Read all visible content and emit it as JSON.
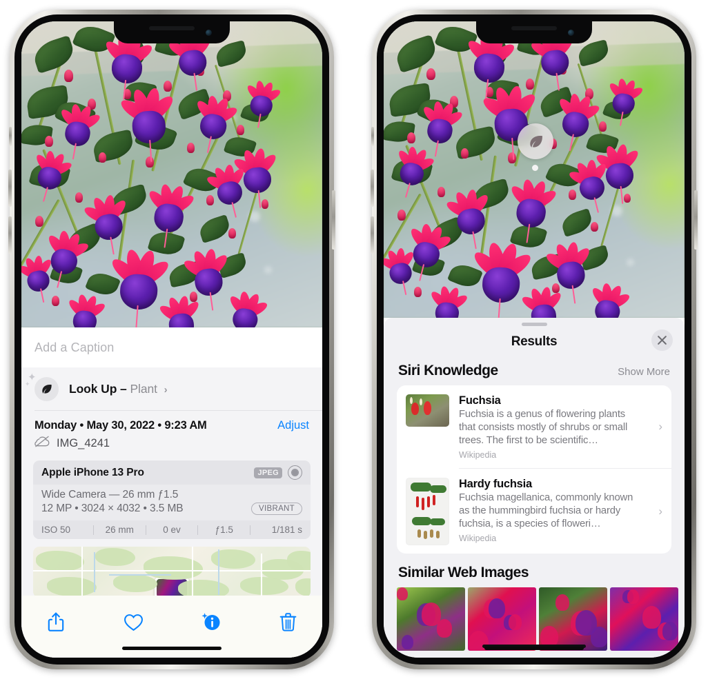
{
  "meta": {
    "description": "Two iPhone 13 Pro screenshots side by side showing the Photos app Visual Look Up feature",
    "accent_blue": "#0a84ff",
    "sheet_bg": "#f1f1f4",
    "card_bg": "#ffffff"
  },
  "left_phone": {
    "caption_field": {
      "value": "",
      "placeholder": "Add a Caption"
    },
    "look_up": {
      "icon": "leaf-icon",
      "sparkle": "sparkle-icon",
      "label": "Look Up –",
      "subject": "Plant",
      "chevron": "›"
    },
    "photo_meta": {
      "date_line": "Monday • May 30, 2022 • 9:23 AM",
      "adjust_label": "Adjust",
      "cloud_icon": "icloud-slash-icon",
      "file_name": "IMG_4241"
    },
    "exif": {
      "device": "Apple iPhone 13 Pro",
      "format_badge": "JPEG",
      "aperture_icon": "aperture-icon",
      "lens_line": "Wide Camera — 26 mm ƒ1.5",
      "size_line": "12 MP • 3024 × 4032 • 3.5 MB",
      "style_badge": "VIBRANT",
      "settings": [
        "ISO 50",
        "26 mm",
        "0 ev",
        "ƒ1.5",
        "1/181 s"
      ]
    },
    "map": {
      "name": "location-map-thumbnail",
      "pin": "photo-pin"
    },
    "toolbar": [
      {
        "name": "share-button",
        "icon": "share-icon"
      },
      {
        "name": "favorite-button",
        "icon": "heart-icon"
      },
      {
        "name": "info-button",
        "icon": "info-sparkle-icon"
      },
      {
        "name": "delete-button",
        "icon": "trash-icon"
      }
    ]
  },
  "right_phone": {
    "badge": {
      "name": "visual-look-up-badge",
      "icon": "leaf-icon"
    },
    "sheet": {
      "grabber": "sheet-grabber",
      "title": "Results",
      "close_icon": "close-icon"
    },
    "siri_knowledge": {
      "title": "Siri Knowledge",
      "show_more": "Show More",
      "items": [
        {
          "title": "Fuchsia",
          "description": "Fuchsia is a genus of flowering plants that consists mostly of shrubs or small trees. The first to be scientific…",
          "source": "Wikipedia",
          "chevron": "›"
        },
        {
          "title": "Hardy fuchsia",
          "description": "Fuchsia magellanica, commonly known as the hummingbird fuchsia or hardy fuchsia, is a species of floweri…",
          "source": "Wikipedia",
          "chevron": "›"
        }
      ]
    },
    "similar_web_images": {
      "title": "Similar Web Images",
      "thumbnails": [
        "fuchsia-pink-white-bloom",
        "fuchsia-red-closeup",
        "fuchsia-bush-buds",
        "fuchsia-purple-hanging"
      ]
    }
  }
}
